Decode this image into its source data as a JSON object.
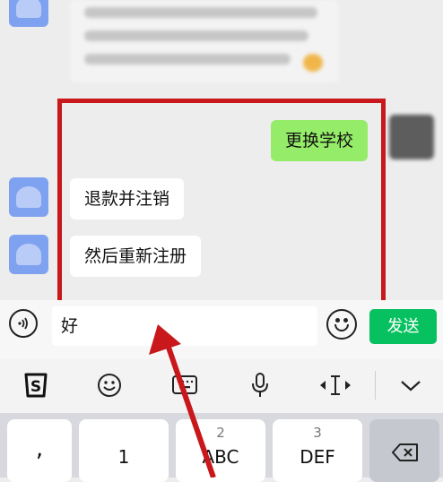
{
  "colors": {
    "background": "#ededed",
    "incoming_bubble": "#ffffff",
    "outgoing_bubble": "#95ec69",
    "send_button": "#07c160",
    "highlight": "#c8181b"
  },
  "chat": {
    "messages": [
      {
        "side": "right",
        "text": "更换学校"
      },
      {
        "side": "left",
        "text": "退款并注销"
      },
      {
        "side": "left",
        "text": "然后重新注册"
      }
    ]
  },
  "input_bar": {
    "voice_icon": "voice-icon",
    "text_value": "好",
    "emoji_icon": "emoji-icon",
    "send_label": "发送"
  },
  "toolbar": {
    "items": [
      "sogou-logo-icon",
      "emoji-icon",
      "keyboard-icon",
      "microphone-icon",
      "cursor-move-icon",
      "collapse-chevron-icon"
    ]
  },
  "keyboard": {
    "keys": [
      {
        "main": ",",
        "num": ""
      },
      {
        "main": "1",
        "num": ""
      },
      {
        "main": "ABC",
        "num": "2"
      },
      {
        "main": "DEF",
        "num": "3"
      },
      {
        "main": "",
        "num": "",
        "icon": "backspace-icon"
      }
    ]
  }
}
